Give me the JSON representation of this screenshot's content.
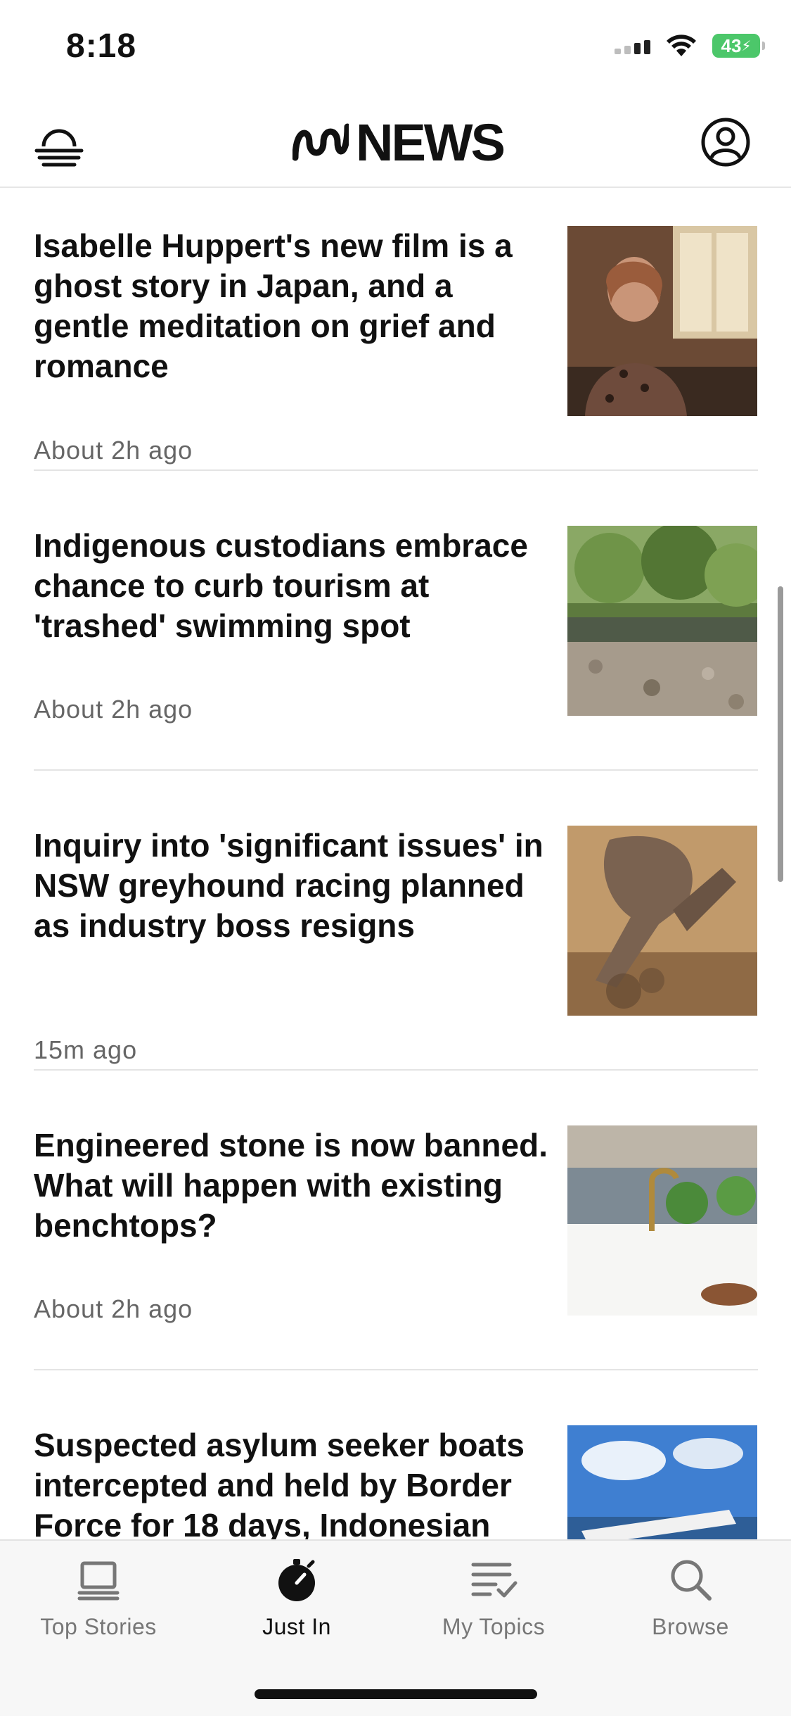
{
  "status_bar": {
    "time": "8:18",
    "battery": "43"
  },
  "header": {
    "logo_text": "NEWS",
    "weather_icon": "weather-cloud-icon",
    "account_icon": "account-icon"
  },
  "articles": [
    {
      "headline": "Isabelle Huppert's new film is a ghost story in Japan, and a gentle meditation on grief and romance",
      "time": "About 2h ago"
    },
    {
      "headline": "Indigenous custodians embrace chance to curb tourism at 'trashed' swimming spot",
      "time": "About 2h ago"
    },
    {
      "headline": "Inquiry into 'significant issues' in NSW greyhound racing planned as industry boss resigns",
      "time": "15m ago"
    },
    {
      "headline": "Engineered stone is now banned. What will happen with existing benchtops?",
      "time": "About 2h ago"
    },
    {
      "headline": "Suspected asylum seeker boats intercepted and held by Border Force for 18 days, Indonesian",
      "time": ""
    }
  ],
  "tabs": [
    {
      "label": "Top Stories",
      "icon": "laptop-icon",
      "active": false
    },
    {
      "label": "Just In",
      "icon": "stopwatch-icon",
      "active": true
    },
    {
      "label": "My Topics",
      "icon": "list-check-icon",
      "active": false
    },
    {
      "label": "Browse",
      "icon": "search-icon",
      "active": false
    }
  ],
  "colors": {
    "battery": "#4cc76a",
    "text": "#111111",
    "secondary_text": "#666666",
    "accent_active": "#111111"
  }
}
